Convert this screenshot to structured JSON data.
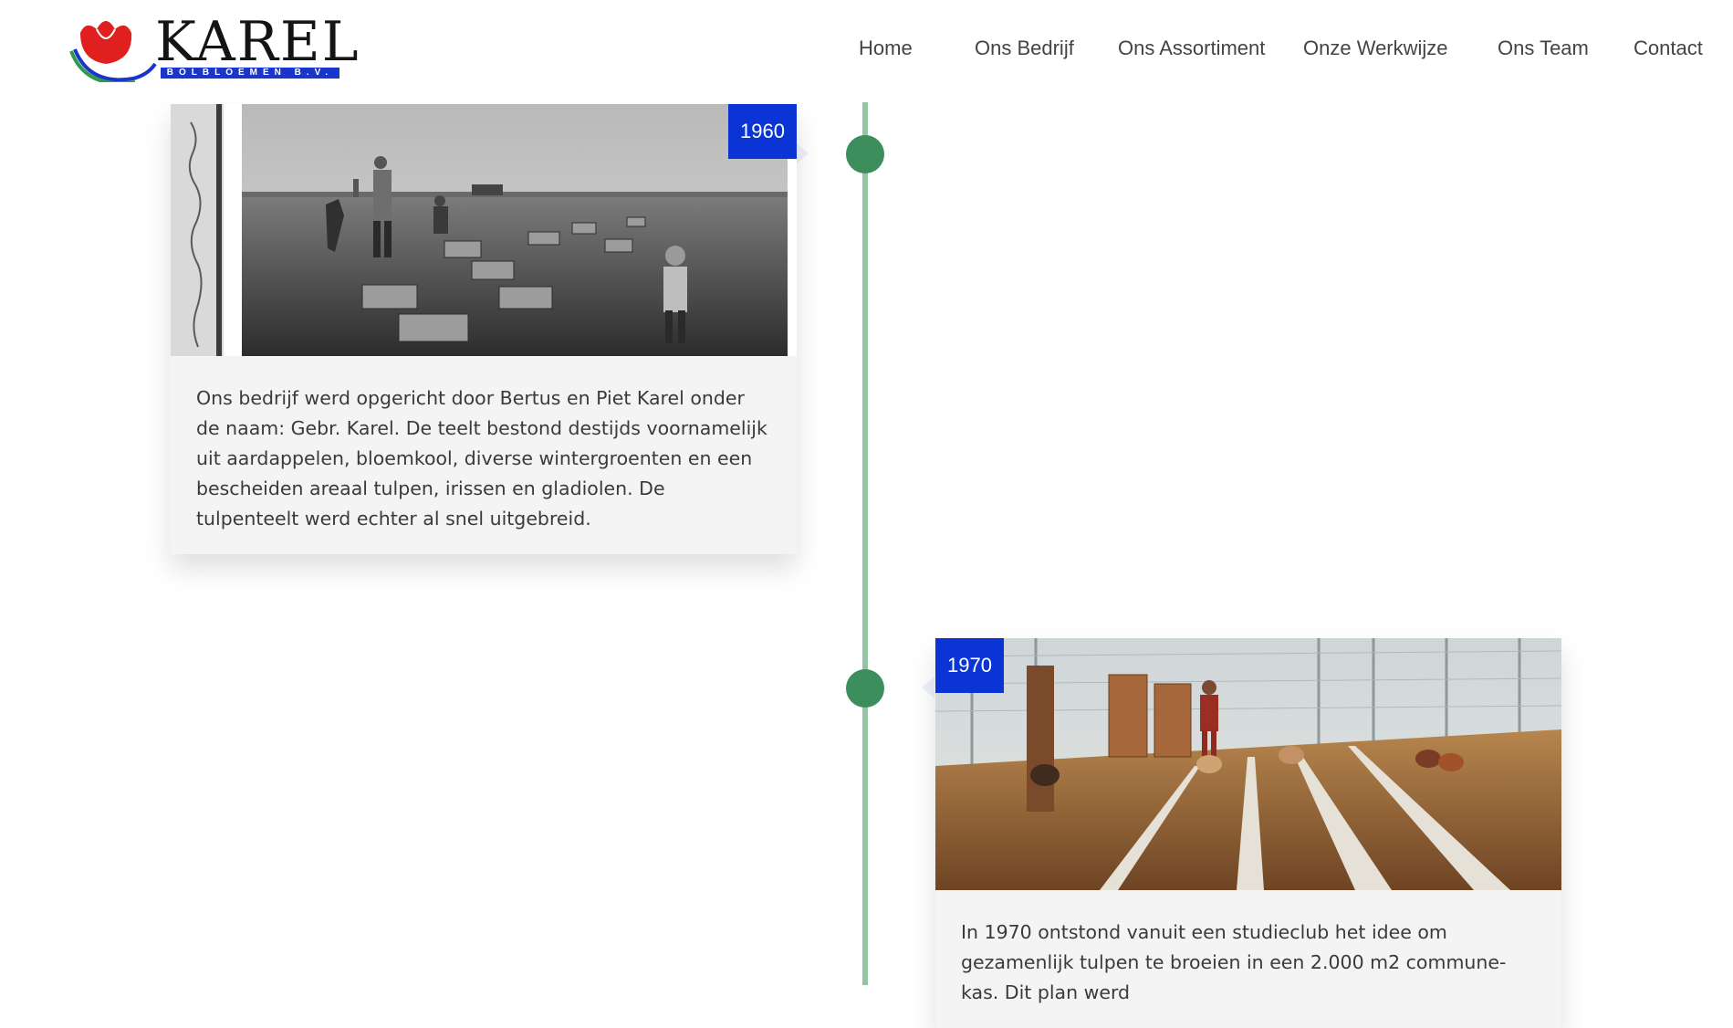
{
  "header": {
    "logo": {
      "word": "KAREL",
      "subtitle": "BOLBLOEMEN B.V."
    },
    "nav": [
      {
        "label": "Home"
      },
      {
        "label": "Ons Bedrijf"
      },
      {
        "label": "Ons Assortiment"
      },
      {
        "label": "Onze Werkwijze"
      },
      {
        "label": "Ons Team"
      },
      {
        "label": "Contact"
      }
    ]
  },
  "timeline": {
    "entries": [
      {
        "year": "1960",
        "text": "Ons bedrijf werd opgericht door Bertus en Piet Karel onder de naam: Gebr. Karel. De teelt bestond destijds voornamelijk uit aardappelen, bloemkool, diverse wintergroenten en een bescheiden areaal tulpen, irissen en gladiolen. De tulpenteelt werd echter al snel uitgebreid."
      },
      {
        "year": "1970",
        "text": "In 1970 ontstond vanuit een studieclub het idee om gezamenlijk tulpen te broeien in een 2.000 m2 commune-kas. Dit plan werd"
      }
    ]
  },
  "colors": {
    "accent_badge": "#0a35d4",
    "timeline_line": "#93c4a3",
    "timeline_dot": "#3c8f5d",
    "card_background": "#f4f4f4"
  }
}
